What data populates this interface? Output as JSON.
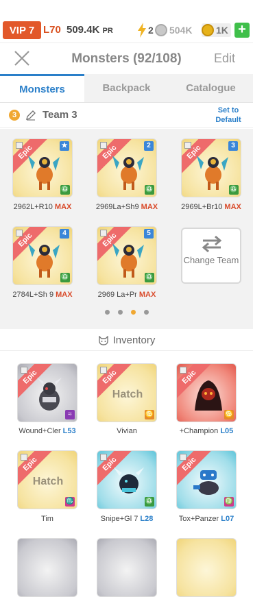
{
  "status": {
    "vip": "VIP 7",
    "level": "L70",
    "power": "509.4K",
    "power_unit": "PR",
    "energy": "2",
    "resource_a": "504K",
    "gems": "1K",
    "plus": "+"
  },
  "header": {
    "title": "Monsters (92/108)",
    "edit": "Edit"
  },
  "tabs": [
    {
      "label": "Monsters",
      "active": true
    },
    {
      "label": "Backpack",
      "active": false
    },
    {
      "label": "Catalogue",
      "active": false
    }
  ],
  "team": {
    "number": "3",
    "name": "Team 3",
    "set_default": "Set to Default"
  },
  "team_members": [
    {
      "name": "2962L+R10",
      "max": "MAX",
      "rarity": "Epic",
      "slot": "★"
    },
    {
      "name": "2969La+Sh9",
      "max": "MAX",
      "rarity": "Epic",
      "slot": "2"
    },
    {
      "name": "2969L+Br10",
      "max": "MAX",
      "rarity": "Epic",
      "slot": "3"
    },
    {
      "name": "2784L+Sh 9",
      "max": "MAX",
      "rarity": "Epic",
      "slot": "4"
    },
    {
      "name": "2969 La+Pr",
      "max": "MAX",
      "rarity": "Epic",
      "slot": "5"
    }
  ],
  "change_team": "Change Team",
  "pager": {
    "pages": 4,
    "active": 2
  },
  "inventory": {
    "title": "Inventory",
    "items": [
      {
        "name": "Wound+Cler",
        "level": "L53",
        "rarity": "Epic",
        "color": "grey",
        "zodiac": "≈"
      },
      {
        "name": "Vivian",
        "level": "",
        "rarity": "Epic",
        "color": "yellow",
        "hatch": "Hatch",
        "zodiac": "♋"
      },
      {
        "name": "+Champion",
        "level": "L05",
        "rarity": "Epic",
        "color": "red",
        "zodiac": "♋"
      },
      {
        "name": "Tim",
        "level": "",
        "rarity": "Epic",
        "color": "yellow",
        "hatch": "Hatch",
        "zodiac": "♏"
      },
      {
        "name": "Snipe+Gl 7",
        "level": "L28",
        "rarity": "Epic",
        "color": "cyan",
        "zodiac": "♎"
      },
      {
        "name": "Tox+Panzer",
        "level": "L07",
        "rarity": "Epic",
        "color": "cyan",
        "zodiac": "♍"
      }
    ]
  }
}
